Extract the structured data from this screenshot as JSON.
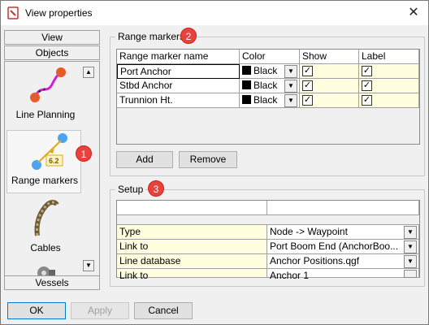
{
  "window": {
    "title": "View properties"
  },
  "nav": {
    "view_header": "View",
    "objects_header": "Objects",
    "vessels_header": "Vessels",
    "items": [
      {
        "label": "Line Planning",
        "icon": "line-planning-icon"
      },
      {
        "label": "Range markers",
        "icon": "range-marker-icon",
        "selected": true
      },
      {
        "label": "Cables",
        "icon": "cable-icon"
      },
      {
        "label": "",
        "icon": "winch-icon"
      }
    ]
  },
  "range_markers": {
    "title": "Range markers",
    "badge": "2",
    "columns": [
      "Range marker name",
      "Color",
      "Show",
      "Label"
    ],
    "rows": [
      {
        "name": "Port Anchor",
        "color": "Black",
        "show": "✓",
        "label": "✓"
      },
      {
        "name": "Stbd Anchor",
        "color": "Black",
        "show": "✓",
        "label": "✓"
      },
      {
        "name": "Trunnion Ht.",
        "color": "Black",
        "show": "✓",
        "label": "✓"
      }
    ],
    "add_label": "Add",
    "remove_label": "Remove"
  },
  "setup": {
    "title": "Setup",
    "badge": "3",
    "rows": [
      {
        "key": "Type",
        "value": "Node -> Waypoint"
      },
      {
        "key": "Link to",
        "value": "Port Boom End (AnchorBoo..."
      },
      {
        "key": "Line database",
        "value": "Anchor Positions.qgf"
      },
      {
        "key": "Link to",
        "value": "Anchor 1"
      }
    ]
  },
  "nav_badge": "1",
  "footer": {
    "ok_label": "OK",
    "apply_label": "Apply",
    "cancel_label": "Cancel"
  },
  "colors": {
    "badge": "#e8423c",
    "highlight_cell": "#ffffe0",
    "accent_border": "#0078d7"
  }
}
